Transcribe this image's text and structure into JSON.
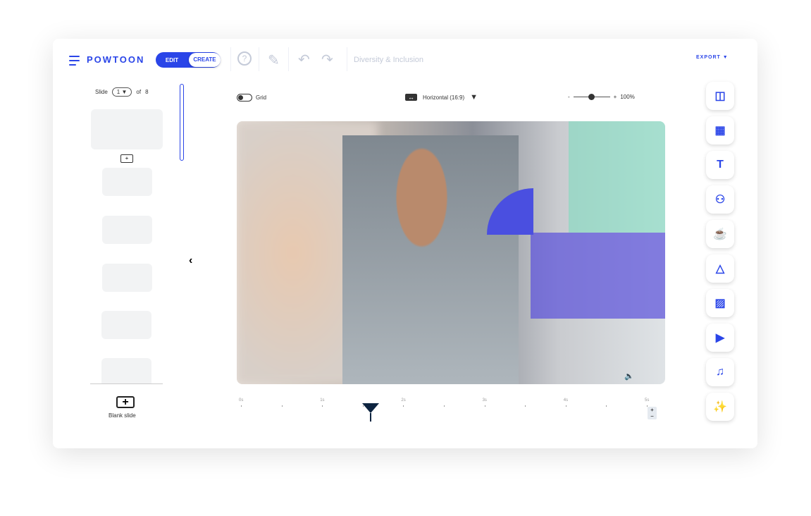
{
  "header": {
    "logo": "POWTOON",
    "edit": "EDIT",
    "create": "CREATE",
    "title": "Diversity & Inclusion",
    "export": "EXPORT"
  },
  "slides": {
    "label": "Slide",
    "current": "1",
    "of": "of",
    "total": "8",
    "blank": "Blank slide"
  },
  "canvas_bar": {
    "grid": "Grid",
    "orientation": "Horizontal (16:9)",
    "zoom": "100%",
    "minus": "-",
    "plus": "+"
  },
  "timeline": {
    "ticks": [
      "0s",
      "1s",
      "2s",
      "3s",
      "4s",
      "5s"
    ],
    "playhead_seconds": 1.6
  },
  "toolbar": [
    "layout-icon",
    "background-icon",
    "text-icon",
    "characters-icon",
    "props-icon",
    "shapes-icon",
    "images-icon",
    "video-icon",
    "music-icon",
    "magic-icon"
  ],
  "colors": {
    "accent": "#2a45e8",
    "playhead": "#0d2440"
  }
}
